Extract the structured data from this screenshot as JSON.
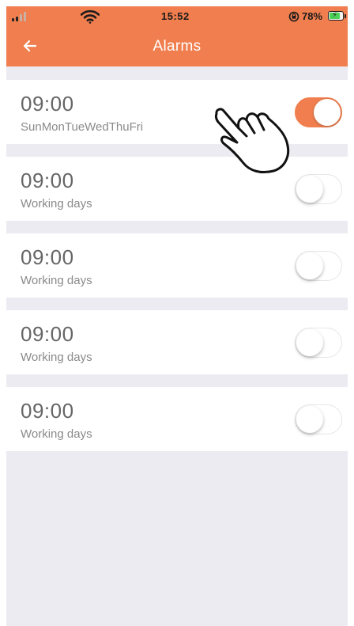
{
  "status_bar": {
    "time": "15:52",
    "battery_percent": "78%",
    "signal_bars_active": 2,
    "battery_level": 0.78,
    "battery_charging": true
  },
  "header": {
    "title": "Alarms",
    "back_icon": "arrow-left-icon",
    "background_color": "#f07e4e"
  },
  "alarms": [
    {
      "time": "09:00",
      "repeat": "SunMonTueWedThuFri",
      "enabled": true
    },
    {
      "time": "09:00",
      "repeat": "Working days",
      "enabled": false
    },
    {
      "time": "09:00",
      "repeat": "Working days",
      "enabled": false
    },
    {
      "time": "09:00",
      "repeat": "Working days",
      "enabled": false
    },
    {
      "time": "09:00",
      "repeat": "Working days",
      "enabled": false
    }
  ],
  "overlay": {
    "icon": "pointing-hand-icon"
  },
  "colors": {
    "accent": "#f07e4e",
    "list_background": "#edebf2"
  }
}
